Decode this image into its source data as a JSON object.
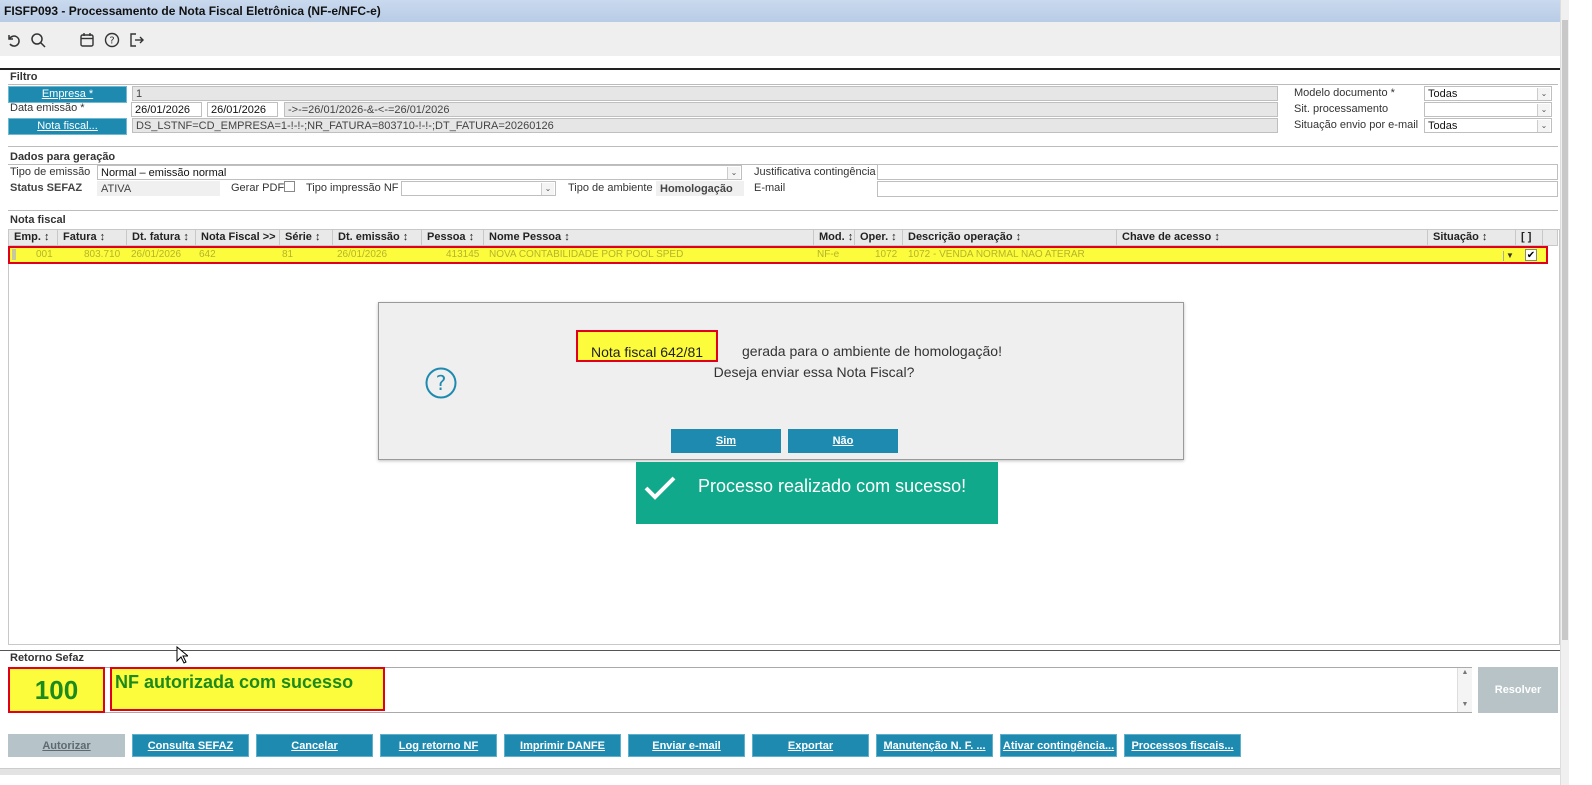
{
  "window": {
    "title": "FISFP093 - Processamento de Nota Fiscal Eletrônica (NF-e/NFC-e)"
  },
  "toolbar": {
    "icons": [
      "undo-icon",
      "search-icon",
      "calendar-icon",
      "help-icon",
      "exit-icon"
    ]
  },
  "filtro": {
    "section_title": "Filtro",
    "empresa_btn": "Empresa *",
    "empresa_value": "1",
    "data_emissao_label": "Data emissão *",
    "data_de": "26/01/2026",
    "data_ate": "26/01/2026",
    "data_expr": "->-=26/01/2026-&-<-=26/01/2026",
    "nota_fiscal_btn": "Nota fiscal...",
    "nota_fiscal_expr": "DS_LSTNF=CD_EMPRESA=1-!-!-;NR_FATURA=803710-!-!-;DT_FATURA=20260126",
    "modelo_doc_label": "Modelo documento *",
    "modelo_doc_value": "Todas",
    "sit_proc_label": "Sit. processamento",
    "sit_proc_value": "",
    "sit_email_label": "Situação envio por e-mail",
    "sit_email_value": "Todas"
  },
  "dados": {
    "section_title": "Dados para geração",
    "tipo_emissao_label": "Tipo de emissão",
    "tipo_emissao_value": "Normal – emissão normal",
    "justificativa_label": "Justificativa contingência",
    "status_sefaz_label": "Status SEFAZ",
    "status_sefaz_value": "ATIVA",
    "gerar_pdf_label": "Gerar PDF",
    "tipo_impressao_label": "Tipo impressão NF",
    "tipo_impressao_value": "",
    "tipo_ambiente_label": "Tipo de ambiente",
    "tipo_ambiente_value": "Homologação",
    "email_label": "E-mail",
    "email_value": ""
  },
  "nota_fiscal": {
    "section_title": "Nota fiscal",
    "columns": [
      "Emp. ↕",
      "Fatura ↕",
      "Dt. fatura ↕",
      "Nota Fiscal >>",
      "Série ↕",
      "Dt. emissão ↕",
      "Pessoa ↕",
      "Nome Pessoa ↕",
      "Mod. ↕",
      "Oper. ↕",
      "Descrição operação ↕",
      "Chave de acesso ↕",
      "Situação ↕",
      "[ ]"
    ],
    "row": {
      "emp": "001",
      "fatura": "803.710",
      "dt_fatura": "26/01/2026",
      "nota_fiscal": "642",
      "serie": "81",
      "dt_emissao": "26/01/2026",
      "pessoa": "413145",
      "nome_pessoa": "NOVA CONTABILIDADE POR POOL SPED",
      "mod": "NF-e",
      "oper": "1072",
      "descricao": "1072 - VENDA NORMAL NAO ATERAR",
      "chave": "",
      "situacao": "",
      "checked": "✔"
    }
  },
  "dialog": {
    "highlight_text": "Nota fiscal 642/81",
    "line1_rest": "gerada para o ambiente de homologação!",
    "line2": "Deseja enviar essa Nota Fiscal?",
    "yes_label": "Sim",
    "no_label": "Não"
  },
  "toast": {
    "message": "Processo realizado com sucesso!"
  },
  "retorno": {
    "section_title": "Retorno Sefaz",
    "code": "100",
    "message": "NF autorizada com sucesso",
    "resolver_label": "Resolver"
  },
  "buttons": {
    "autorizar": "Autorizar",
    "consulta_sefaz": "Consulta SEFAZ",
    "cancelar": "Cancelar",
    "log_retorno": "Log retorno NF",
    "imprimir_danfe": "Imprimir DANFE",
    "enviar_email": "Enviar e-mail",
    "exportar": "Exportar",
    "manutencao": "Manutenção N. F. ...",
    "ativar_contingencia": "Ativar contingência...",
    "processos_fiscais": "Processos fiscais..."
  },
  "colors": {
    "teal": "#1f8ab0",
    "highlight": "#fdfc3c",
    "highlight_border": "#e0001b",
    "success": "#11a98b"
  }
}
